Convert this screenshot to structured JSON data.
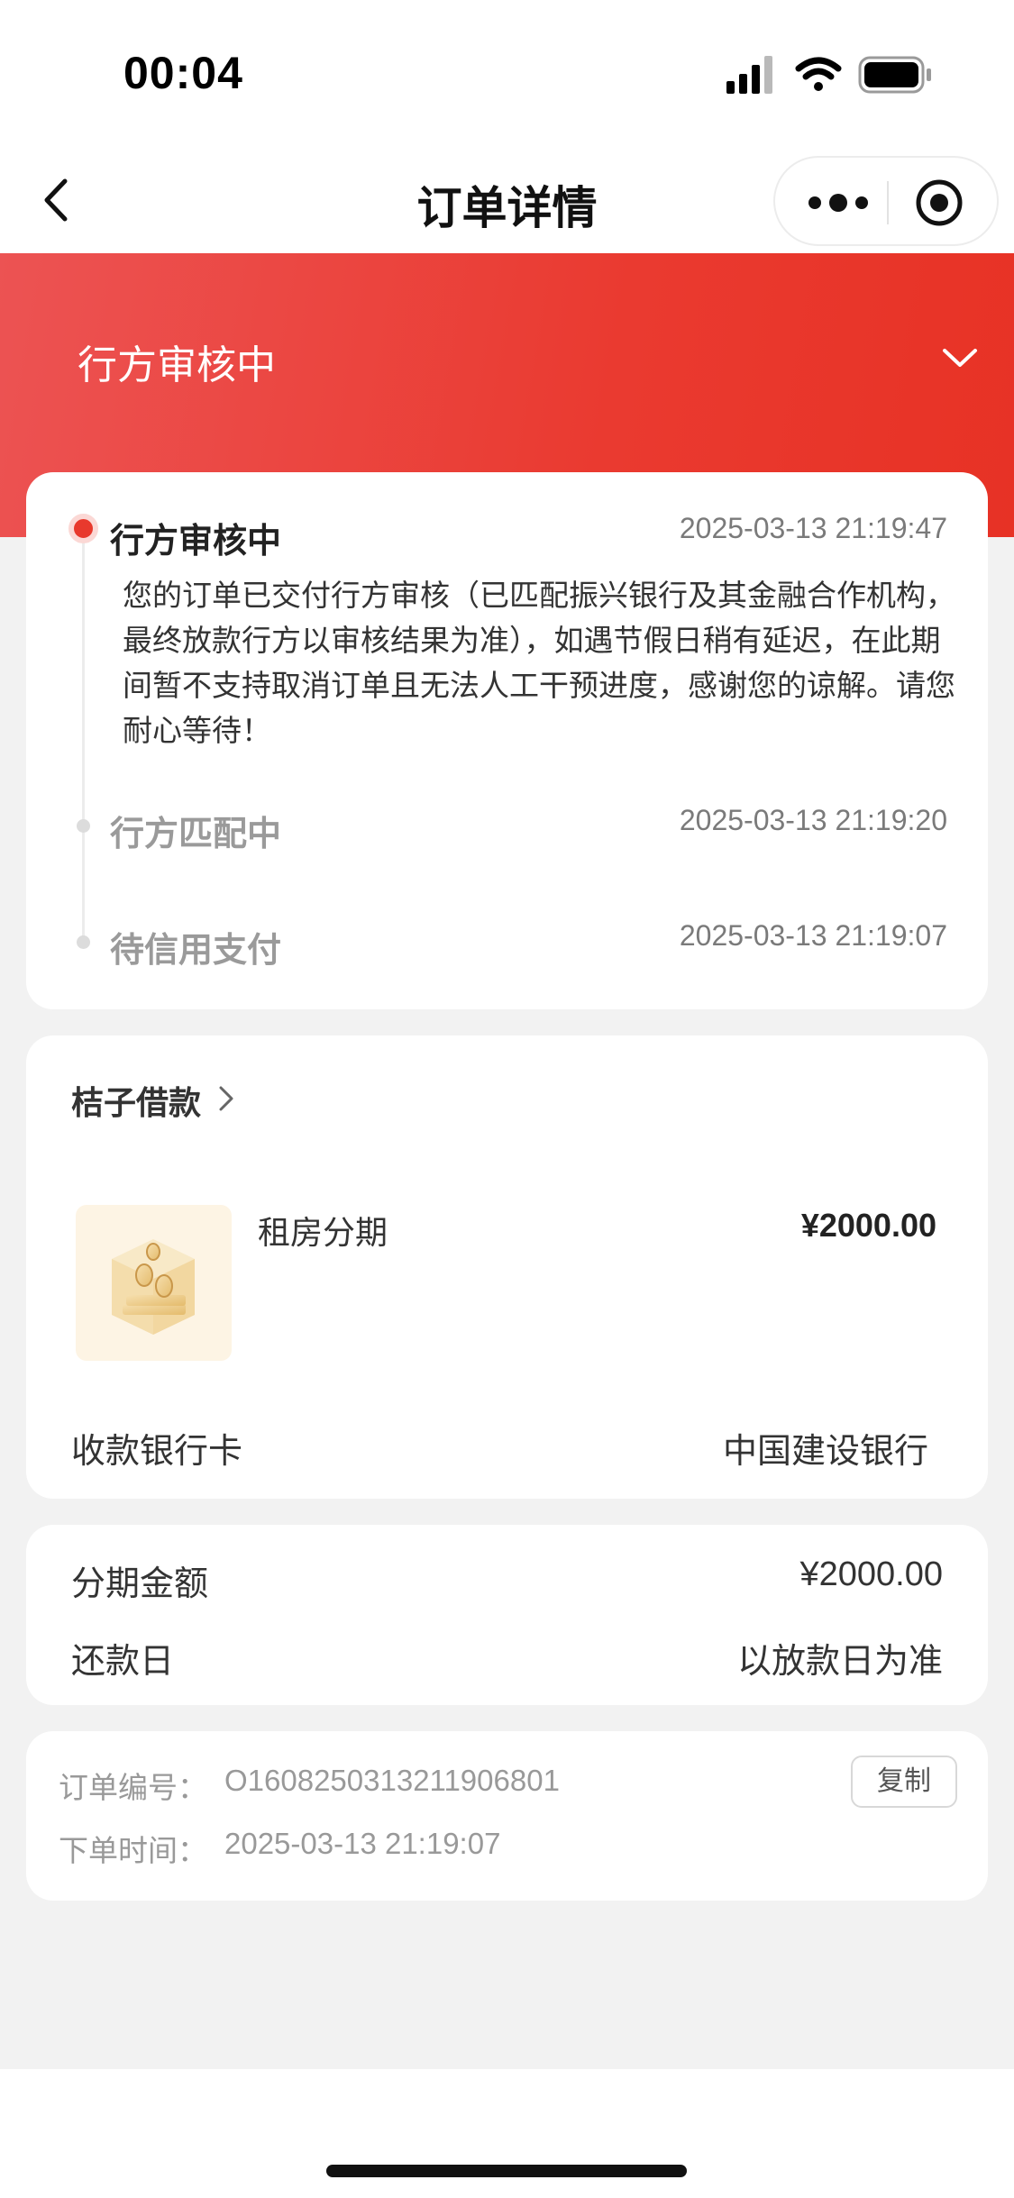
{
  "status_bar": {
    "time": "00:04"
  },
  "nav": {
    "title": "订单详情"
  },
  "banner": {
    "title": "行方审核中"
  },
  "timeline": [
    {
      "title": "行方审核中",
      "time": "2025-03-13 21:19:47",
      "description": "您的订单已交付行方审核（已匹配振兴银行及其金融合作机构，最终放款行方以审核结果为准），如遇节假日稍有延迟，在此期间暂不支持取消订单且无法人工干预进度，感谢您的谅解。请您耐心等待！"
    },
    {
      "title": "行方匹配中",
      "time": "2025-03-13 21:19:20"
    },
    {
      "title": "待信用支付",
      "time": "2025-03-13 21:19:07"
    }
  ],
  "product": {
    "merchant": "桔子借款",
    "name": "租房分期",
    "price": "¥2000.00",
    "bank_label": "收款银行卡",
    "bank_value": "中国建设银行"
  },
  "amount": {
    "installment_label": "分期金额",
    "installment_value": "¥2000.00",
    "repay_label": "还款日",
    "repay_value": "以放款日为准"
  },
  "order": {
    "number_label": "订单编号：",
    "number_value": "O1608250313211906801",
    "copy_label": "复制",
    "time_label": "下单时间：",
    "time_value": "2025-03-13 21:19:07"
  },
  "colors": {
    "accent": "#e8392d",
    "background": "#f2f2f2"
  }
}
